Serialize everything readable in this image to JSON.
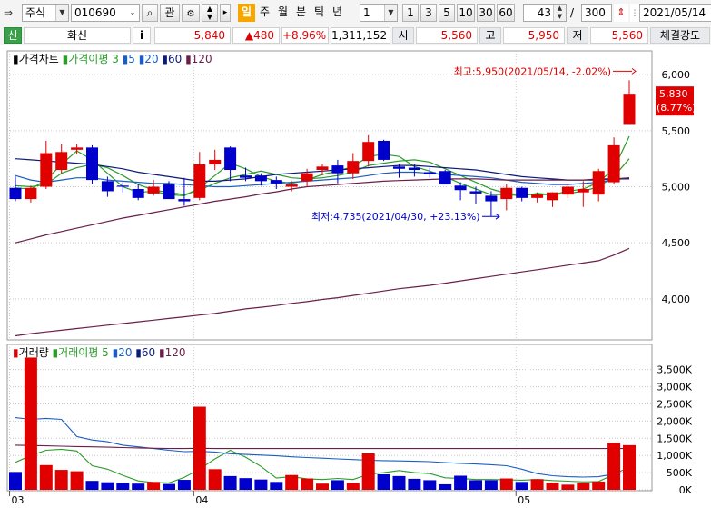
{
  "toolbar": {
    "market": "주식",
    "code": "010690",
    "btn_search": "⌕",
    "btn_watch": "관",
    "periods": [
      "일",
      "주",
      "월",
      "분",
      "틱",
      "년"
    ],
    "active_period": 0,
    "unit_value": "1",
    "minute_choices": [
      "1",
      "3",
      "5",
      "10",
      "30",
      "60"
    ],
    "count_shown": "43",
    "count_sep": "/",
    "count_total": "300",
    "date": "2021/05/14"
  },
  "quote": {
    "badge": "신",
    "name": "화신",
    "info_button": "i",
    "price": "5,840",
    "change": "▲480",
    "change_pct": "+8.96%",
    "volume": "1,311,152",
    "open_label": "시",
    "open": "5,560",
    "high_label": "고",
    "high": "5,950",
    "low_label": "저",
    "low": "5,560",
    "strength_label": "체결강도"
  },
  "colors": {
    "up": "#e00000",
    "down": "#0000cc",
    "ma3": "#2a9d2a",
    "ma5": "#2a9d2a",
    "ma20": "#1a5ec4",
    "ma60": "#0b1b7a",
    "ma120": "#6a1f4a",
    "accent_tab": "#f7a600"
  },
  "chart_data": [
    {
      "type": "candlestick",
      "name": "price",
      "legend": {
        "title": "가격차트",
        "ma_label": "가격이평",
        "periods": [
          "3",
          "5",
          "20",
          "60",
          "120"
        ]
      },
      "x_labels": [
        {
          "index": 0,
          "label": "03"
        },
        {
          "index": 12,
          "label": "04"
        },
        {
          "index": 33,
          "label": "05"
        }
      ],
      "ylim": [
        3650,
        6180
      ],
      "y_ticks": [
        4000,
        4500,
        5000,
        5500,
        6000
      ],
      "y_tick_labels": [
        "4,000",
        "4,500",
        "5,000",
        "5,500",
        "6,000"
      ],
      "last_price_label": "5,830",
      "last_price_pct": "(8.77%)",
      "high_annotation": "최고:5,950(2021/05/14, -2.02%)",
      "low_annotation": "최저:4,735(2021/04/30, +23.13%)",
      "ohlc": [
        [
          4990,
          5090,
          4870,
          4890
        ],
        [
          4890,
          5010,
          4860,
          4990
        ],
        [
          5000,
          5410,
          4980,
          5300
        ],
        [
          5150,
          5380,
          5120,
          5310
        ],
        [
          5330,
          5380,
          5290,
          5350
        ],
        [
          5350,
          5370,
          5020,
          5060
        ],
        [
          5050,
          5090,
          4910,
          4960
        ],
        [
          5010,
          5040,
          4950,
          5000
        ],
        [
          4980,
          5020,
          4880,
          4900
        ],
        [
          4940,
          5060,
          4920,
          5000
        ],
        [
          5020,
          5050,
          4910,
          4890
        ],
        [
          4890,
          5080,
          4830,
          4870
        ],
        [
          4900,
          5310,
          4880,
          5200
        ],
        [
          5200,
          5330,
          5150,
          5240
        ],
        [
          5350,
          5360,
          5050,
          5150
        ],
        [
          5100,
          5170,
          5050,
          5080
        ],
        [
          5100,
          5120,
          5010,
          5050
        ],
        [
          5060,
          5090,
          4980,
          5030
        ],
        [
          5000,
          5050,
          4960,
          5020
        ],
        [
          5050,
          5160,
          5000,
          5120
        ],
        [
          5150,
          5200,
          5100,
          5180
        ],
        [
          5190,
          5240,
          5030,
          5120
        ],
        [
          5120,
          5300,
          5070,
          5230
        ],
        [
          5230,
          5460,
          5180,
          5400
        ],
        [
          5410,
          5420,
          5230,
          5240
        ],
        [
          5180,
          5200,
          5080,
          5160
        ],
        [
          5170,
          5200,
          5090,
          5150
        ],
        [
          5130,
          5170,
          5080,
          5110
        ],
        [
          5140,
          5150,
          5020,
          5020
        ],
        [
          5010,
          5040,
          4880,
          4970
        ],
        [
          4960,
          5000,
          4850,
          4940
        ],
        [
          4920,
          4960,
          4735,
          4870
        ],
        [
          4890,
          5020,
          4790,
          4990
        ],
        [
          4990,
          5000,
          4870,
          4900
        ],
        [
          4900,
          4950,
          4860,
          4930
        ],
        [
          4880,
          4950,
          4820,
          4950
        ],
        [
          4930,
          5020,
          4900,
          5000
        ],
        [
          4950,
          5050,
          4820,
          4980
        ],
        [
          4930,
          5160,
          4870,
          5140
        ],
        [
          5040,
          5440,
          5020,
          5370
        ],
        [
          5560,
          5950,
          5560,
          5830
        ]
      ],
      "series": [
        {
          "name": "3",
          "values": [
            4990,
            4980,
            5060,
            5200,
            5320,
            5240,
            5120,
            5000,
            4950,
            4960,
            4930,
            4920,
            4990,
            5100,
            5210,
            5160,
            5090,
            5050,
            5030,
            5060,
            5110,
            5140,
            5180,
            5270,
            5290,
            5270,
            5180,
            5140,
            5090,
            5030,
            4980,
            4930,
            4930,
            4920,
            4940,
            4930,
            4960,
            4980,
            5040,
            5160,
            5450
          ]
        },
        {
          "name": "5",
          "values": [
            5010,
            5000,
            5020,
            5120,
            5170,
            5200,
            5170,
            5100,
            5020,
            4970,
            4950,
            4930,
            4970,
            5030,
            5080,
            5110,
            5140,
            5110,
            5080,
            5070,
            5080,
            5100,
            5130,
            5190,
            5210,
            5230,
            5240,
            5220,
            5160,
            5100,
            5040,
            4980,
            4940,
            4930,
            4930,
            4930,
            4940,
            4960,
            5000,
            5090,
            5250
          ]
        },
        {
          "name": "20",
          "values": [
            5100,
            5060,
            5040,
            5060,
            5080,
            5080,
            5060,
            5050,
            5040,
            5030,
            5030,
            5020,
            5010,
            5000,
            5000,
            5010,
            5020,
            5030,
            5040,
            5050,
            5060,
            5070,
            5080,
            5100,
            5120,
            5130,
            5130,
            5120,
            5110,
            5100,
            5090,
            5080,
            5060,
            5040,
            5030,
            5020,
            5020,
            5030,
            5040,
            5060,
            5080
          ]
        },
        {
          "name": "60",
          "values": [
            5250,
            5240,
            5230,
            5220,
            5210,
            5200,
            5180,
            5160,
            5130,
            5110,
            5090,
            5070,
            5050,
            5050,
            5060,
            5070,
            5090,
            5110,
            5120,
            5130,
            5140,
            5150,
            5160,
            5170,
            5180,
            5190,
            5190,
            5180,
            5170,
            5160,
            5150,
            5130,
            5110,
            5090,
            5080,
            5070,
            5060,
            5060,
            5060,
            5070,
            5070
          ]
        },
        {
          "name": "120",
          "values": [
            4500,
            4535,
            4570,
            4600,
            4630,
            4660,
            4690,
            4720,
            4745,
            4770,
            4795,
            4820,
            4845,
            4870,
            4890,
            4910,
            4935,
            4955,
            4980,
            5000,
            5010,
            5020,
            5030,
            5040,
            5050,
            5055,
            5060,
            5065,
            5070,
            5070,
            5070,
            5065,
            5060,
            5060,
            5060,
            5060,
            5060,
            5060,
            5070,
            5070,
            5080
          ]
        },
        {
          "name": "long",
          "values": [
            3670,
            3690,
            3705,
            3720,
            3735,
            3750,
            3765,
            3780,
            3795,
            3810,
            3825,
            3840,
            3855,
            3870,
            3890,
            3910,
            3925,
            3940,
            3960,
            3975,
            3995,
            4010,
            4030,
            4050,
            4070,
            4090,
            4105,
            4120,
            4140,
            4160,
            4180,
            4200,
            4220,
            4240,
            4260,
            4280,
            4300,
            4320,
            4340,
            4390,
            4450
          ]
        }
      ]
    },
    {
      "type": "bar",
      "name": "volume",
      "legend": {
        "title": "거래량",
        "ma_label": "거래이평",
        "periods": [
          "5",
          "20",
          "60",
          "120"
        ]
      },
      "ylim": [
        0,
        4100000
      ],
      "y_ticks": [
        0,
        500000,
        1000000,
        1500000,
        2000000,
        2500000,
        3000000,
        3500000
      ],
      "y_tick_labels": [
        "0K",
        "500K",
        "1,000K",
        "1,500K",
        "2,000K",
        "2,500K",
        "3,000K",
        "3,500K"
      ],
      "values": [
        520000,
        3850000,
        720000,
        580000,
        540000,
        260000,
        220000,
        200000,
        180000,
        230000,
        170000,
        290000,
        2420000,
        600000,
        400000,
        340000,
        300000,
        230000,
        430000,
        330000,
        180000,
        280000,
        200000,
        1060000,
        450000,
        400000,
        320000,
        280000,
        160000,
        410000,
        280000,
        280000,
        330000,
        230000,
        310000,
        210000,
        150000,
        200000,
        240000,
        1370000,
        1300000
      ],
      "series": [
        {
          "name": "5",
          "values": [
            800000,
            1000000,
            1150000,
            1180000,
            1130000,
            700000,
            600000,
            420000,
            260000,
            210000,
            200000,
            360000,
            600000,
            900000,
            1150000,
            950000,
            680000,
            340000,
            380000,
            320000,
            300000,
            330000,
            300000,
            450000,
            500000,
            560000,
            500000,
            470000,
            350000,
            330000,
            300000,
            300000,
            290000,
            280000,
            300000,
            270000,
            250000,
            230000,
            240000,
            450000,
            660000
          ]
        },
        {
          "name": "20",
          "values": [
            2100000,
            2050000,
            2080000,
            2050000,
            1550000,
            1450000,
            1400000,
            1300000,
            1250000,
            1200000,
            1150000,
            1110000,
            1120000,
            1100000,
            1050000,
            1030000,
            1010000,
            990000,
            960000,
            940000,
            920000,
            900000,
            880000,
            860000,
            850000,
            840000,
            830000,
            820000,
            790000,
            770000,
            750000,
            730000,
            700000,
            600000,
            470000,
            410000,
            380000,
            370000,
            380000,
            460000,
            520000
          ]
        },
        {
          "name": "60",
          "values": [
            1300000,
            1290000,
            1280000,
            1270000,
            1260000,
            1250000,
            1240000,
            1230000,
            1220000,
            1210000,
            1200000,
            1200000,
            1210000,
            1200000,
            1200000,
            1200000,
            1200000,
            1200000,
            1200000,
            1200000,
            1200000,
            1200000,
            1200000,
            1200000,
            1200000,
            1200000,
            1200000,
            1200000,
            1200000,
            1200000,
            1200000,
            1200000,
            1200000,
            1200000,
            1200000,
            1200000,
            1200000,
            1200000,
            1200000,
            1200000,
            1200000
          ]
        }
      ]
    }
  ]
}
